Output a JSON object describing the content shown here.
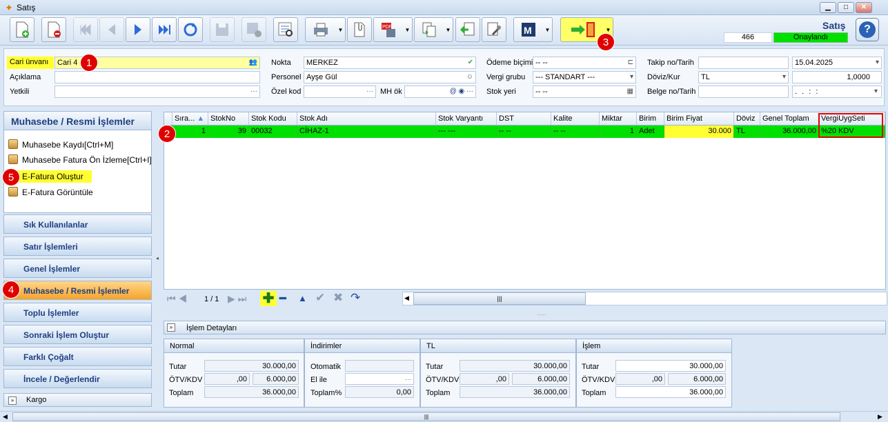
{
  "window": {
    "title": "Satış"
  },
  "header": {
    "doc_type": "Satış",
    "number": "466",
    "status": "Onaylandı",
    "status_color": "#00e000"
  },
  "form": {
    "cari_label": "Cari ünvanı",
    "cari_value": "Cari 4",
    "aciklama_label": "Açıklama",
    "aciklama_value": "",
    "yetkili_label": "Yetkili",
    "yetkili_value": "",
    "nokta_label": "Nokta",
    "nokta_value": "MERKEZ",
    "personel_label": "Personel",
    "personel_value": "Ayşe Gül",
    "ozelkod_label": "Özel kod",
    "ozelkod_value": "",
    "mhok_label": "MH ök",
    "mhok_value": "",
    "odeme_label": "Ödeme biçimi",
    "odeme_value": "-- --",
    "vergi_label": "Vergi grubu",
    "vergi_value": "--- STANDART ---",
    "stokyeri_label": "Stok yeri",
    "stokyeri_value": "-- --",
    "takip_label": "Takip no/Tarih",
    "takip_value": "",
    "takip_date": "15.04.2025",
    "doviz_label": "Döviz/Kur",
    "doviz_value": "TL",
    "kur_value": "1,0000",
    "belge_label": "Belge no/Tarih",
    "belge_value": "",
    "belge_date": ". .  : :"
  },
  "left_panel": {
    "title": "Muhasebe / Resmi İşlemler",
    "items": [
      {
        "label": "Muhasebe Kaydı[Ctrl+M]"
      },
      {
        "label": "Muhasebe Fatura Ön İzleme[Ctrl+I]"
      },
      {
        "label": "E-Fatura Oluştur"
      },
      {
        "label": "E-Fatura Görüntüle"
      }
    ],
    "nav": [
      {
        "label": "Sık Kullanılanlar"
      },
      {
        "label": "Satır İşlemleri"
      },
      {
        "label": "Genel İşlemler"
      },
      {
        "label": "Muhasebe / Resmi İşlemler"
      },
      {
        "label": "Toplu İşlemler"
      },
      {
        "label": "Sonraki İşlem Oluştur"
      },
      {
        "label": "Farklı Çoğalt"
      },
      {
        "label": "İncele / Değerlendir"
      }
    ],
    "kargo": "Kargo"
  },
  "grid": {
    "headers": [
      "Sıra...",
      "StokNo",
      "Stok Kodu",
      "Stok Adı",
      "Stok Varyantı",
      "DST",
      "Kalite",
      "Miktar",
      "Birim",
      "Birim Fiyat",
      "Döviz",
      "Genel Toplam",
      "VergiUygSeti"
    ],
    "row": [
      "1",
      "39",
      "00032",
      "CİHAZ-1",
      "--- ---",
      "-- --",
      "-- --",
      "1",
      "Adet",
      "30.000",
      "TL",
      "36.000,00",
      "%20 KDV"
    ],
    "page": "1 / 1"
  },
  "details": {
    "title": "İşlem Detayları",
    "normal": {
      "title": "Normal",
      "tutar_label": "Tutar",
      "tutar": "30.000,00",
      "otv_label": "ÖTV/KDV",
      "otv": ",00",
      "kdv": "6.000,00",
      "toplam_label": "Toplam",
      "toplam": "36.000,00"
    },
    "indirimler": {
      "title": "İndirimler",
      "otomatik_label": "Otomatik",
      "otomatik": "",
      "elile_label": "El ile",
      "elile": "",
      "toplam_label": "Toplam%",
      "toplam": "0,00"
    },
    "tl": {
      "title": "TL",
      "tutar_label": "Tutar",
      "tutar": "30.000,00",
      "otv_label": "ÖTV/KDV",
      "otv": ",00",
      "kdv": "6.000,00",
      "toplam_label": "Toplam",
      "toplam": "36.000,00"
    },
    "islem": {
      "title": "İşlem",
      "tutar_label": "Tutar",
      "tutar": "30.000,00",
      "otv_label": "ÖTV/KDV",
      "otv": ",00",
      "kdv": "6.000,00",
      "toplam_label": "Toplam",
      "toplam": "36.000,00"
    }
  },
  "callouts": [
    "1",
    "2",
    "3",
    "4",
    "5"
  ]
}
